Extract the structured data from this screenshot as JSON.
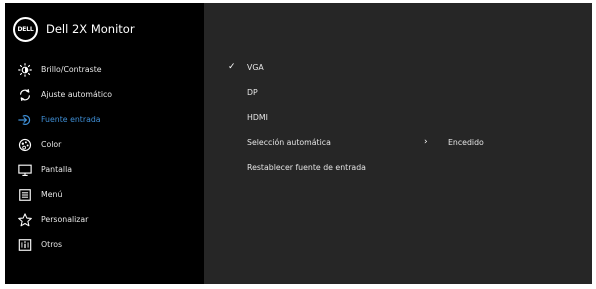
{
  "header": {
    "logo_text": "DELL",
    "title": "Dell 2X Monitor"
  },
  "menu": {
    "items": [
      {
        "label": "Brillo/Contraste",
        "icon": "brightness-icon"
      },
      {
        "label": "Ajuste automático",
        "icon": "auto-adjust-icon"
      },
      {
        "label": "Fuente entrada",
        "icon": "input-source-icon",
        "active": true
      },
      {
        "label": "Color",
        "icon": "color-icon"
      },
      {
        "label": "Pantalla",
        "icon": "display-icon"
      },
      {
        "label": "Menú",
        "icon": "menu-icon"
      },
      {
        "label": "Personalizar",
        "icon": "star-icon"
      },
      {
        "label": "Otros",
        "icon": "info-icon"
      }
    ]
  },
  "content": {
    "options": [
      {
        "label": "VGA",
        "checked": "✓"
      },
      {
        "label": "DP"
      },
      {
        "label": "HDMI"
      },
      {
        "label": "Selección automática",
        "chevron": "›",
        "value": "Encedido"
      },
      {
        "label": "Restablecer fuente de entrada"
      }
    ]
  },
  "colors": {
    "accent": "#3f8fd6",
    "panel_left": "#000000",
    "panel_right": "#262626"
  }
}
